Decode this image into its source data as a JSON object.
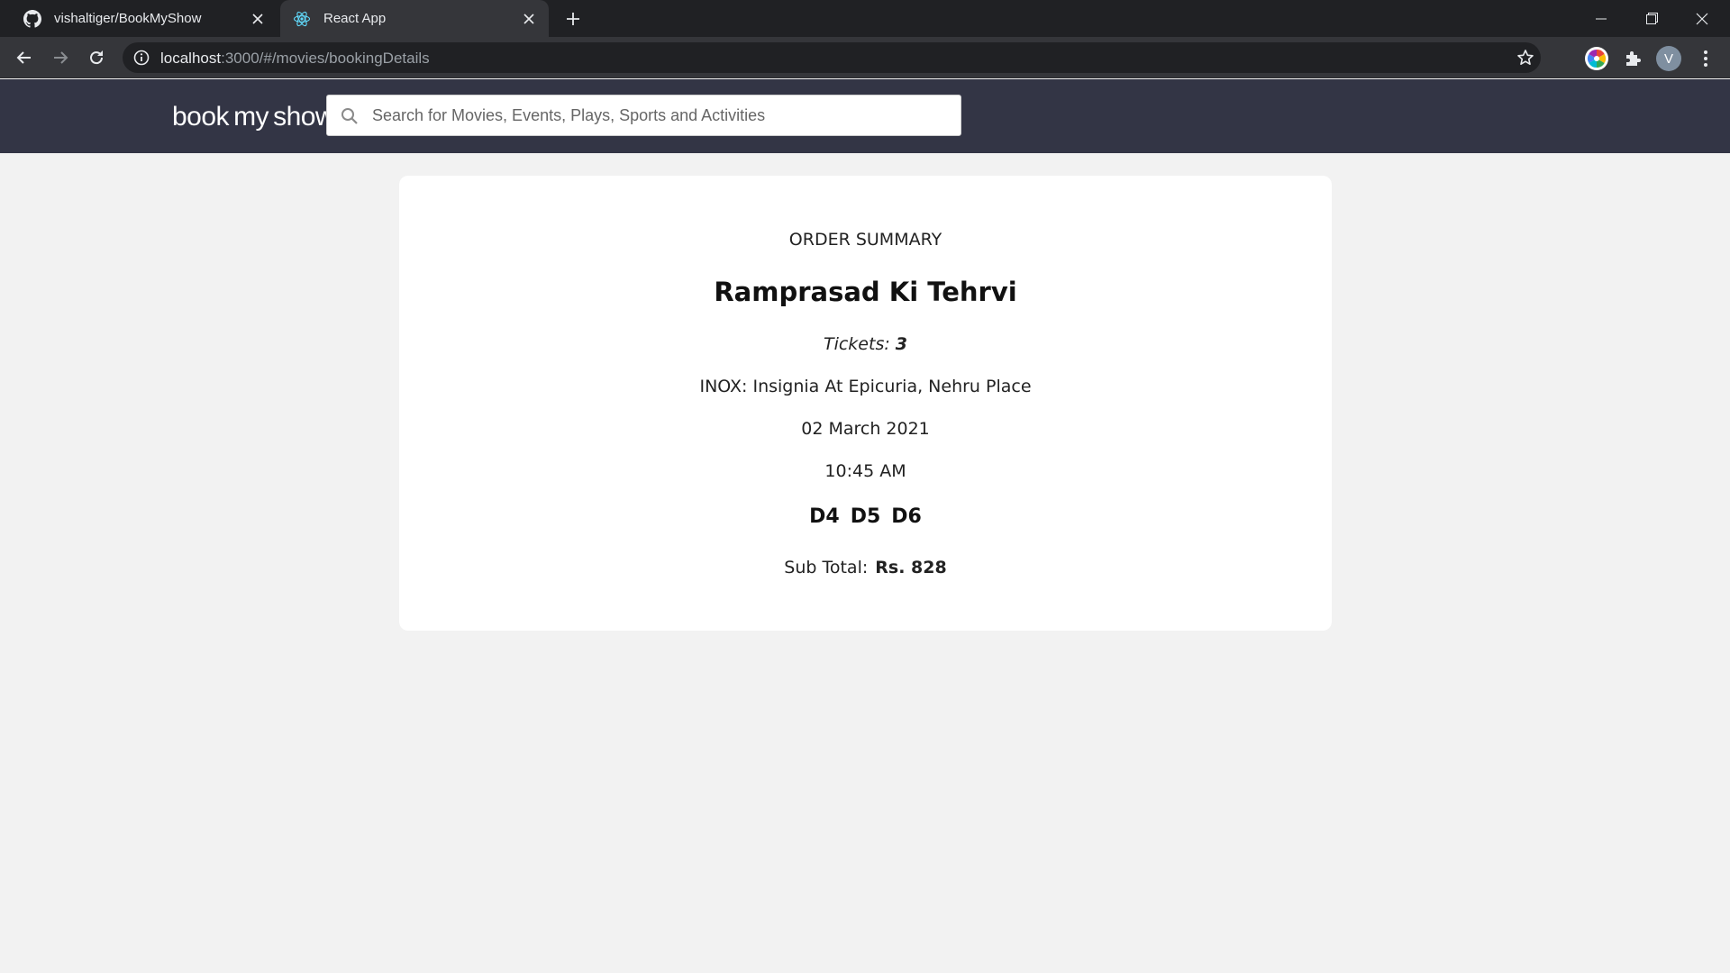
{
  "browser": {
    "tabs": [
      {
        "title": "vishaltiger/BookMyShow",
        "icon": "github-icon",
        "active": false
      },
      {
        "title": "React App",
        "icon": "react-icon",
        "active": true
      }
    ],
    "url_host": "localhost",
    "url_rest": ":3000/#/movies/bookingDetails",
    "profile_initial": "V"
  },
  "app": {
    "logo": {
      "part1": "book",
      "part2": "my",
      "part3": "show"
    },
    "search_placeholder": "Search for Movies, Events, Plays, Sports and Activities",
    "brand_color": "#e31b23",
    "header_color": "#333545"
  },
  "order": {
    "heading": "ORDER SUMMARY",
    "movie": "Ramprasad Ki Tehrvi",
    "tickets_label": "Tickets:",
    "tickets_count": "3",
    "venue": "INOX: Insignia At Epicuria, Nehru Place",
    "date": "02 March 2021",
    "time": "10:45 AM",
    "seats": [
      "D4",
      "D5",
      "D6"
    ],
    "subtotal_label": "Sub Total:",
    "subtotal_value": "Rs. 828"
  }
}
